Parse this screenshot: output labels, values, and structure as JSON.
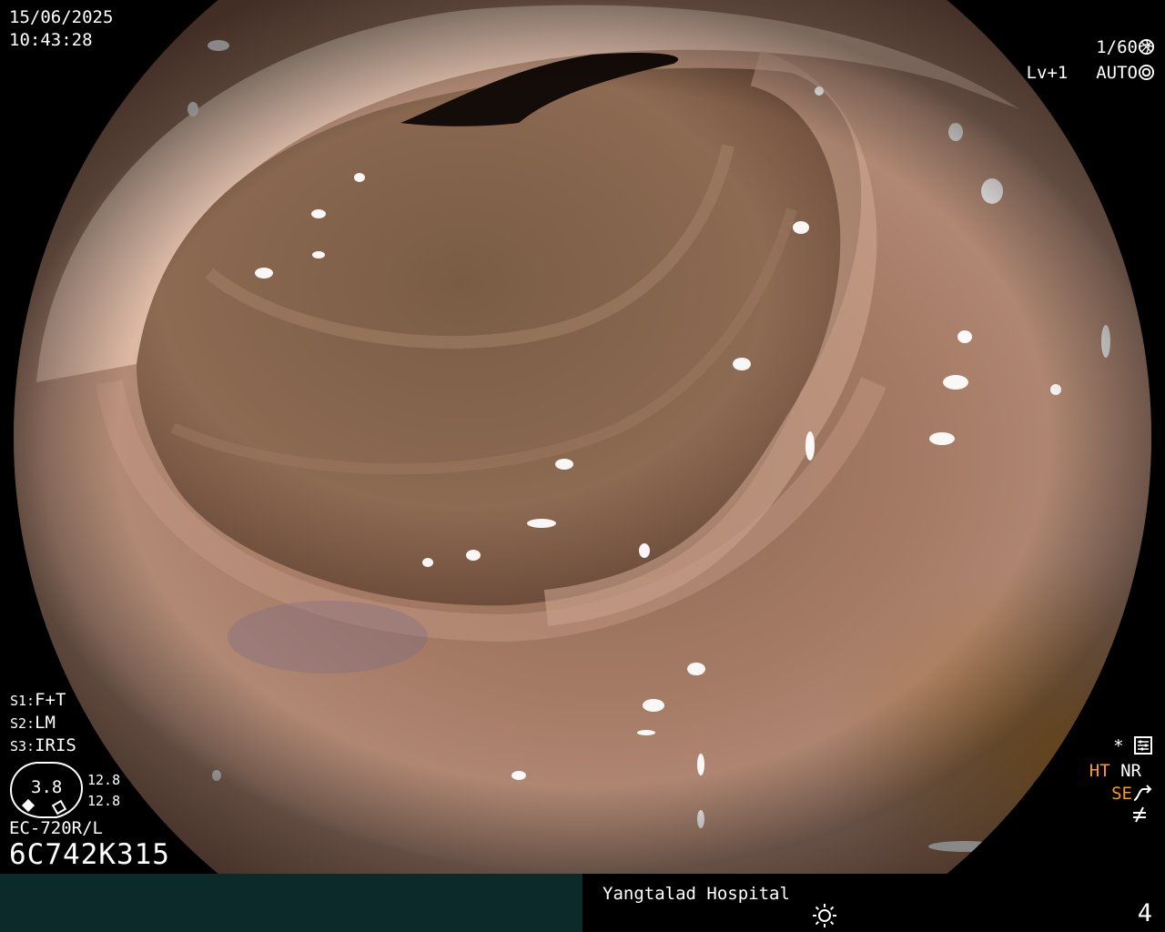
{
  "header": {
    "date": "15/06/2025",
    "time": "10:43:28"
  },
  "exposure": {
    "shutter": "1/60",
    "shutter_icon": "aperture-icon",
    "level": "Lv+1",
    "mode": "AUTO",
    "mode_icon": "iris-icon"
  },
  "settings": {
    "s1_label": "S1:",
    "s1_value": "F+T",
    "s2_label": "S2:",
    "s2_value": "LM",
    "s3_label": "S3:",
    "s3_value": "IRIS"
  },
  "gauge": {
    "center_value": "3.8",
    "upper_value": "12.8",
    "lower_value": "12.8"
  },
  "scope": {
    "model": "EC-720R/L",
    "serial": "6C742K315"
  },
  "processing": {
    "star": "*",
    "ht": "HT",
    "nr": "NR",
    "se": "SE",
    "flags_icon": "settings-sliders-icon",
    "se_icon": "curve-arrow-icon",
    "off_icon": "not-equal-icon"
  },
  "footer": {
    "hospital": "Yangtalad Hospital",
    "brightness_icon": "sun-icon",
    "image_number": "4"
  },
  "colors": {
    "overlay_text": "#ffffff",
    "accent_orange": "#ff9a1a",
    "footer_left_bg": "#0d2a2a",
    "footer_right_bg": "#000000"
  }
}
